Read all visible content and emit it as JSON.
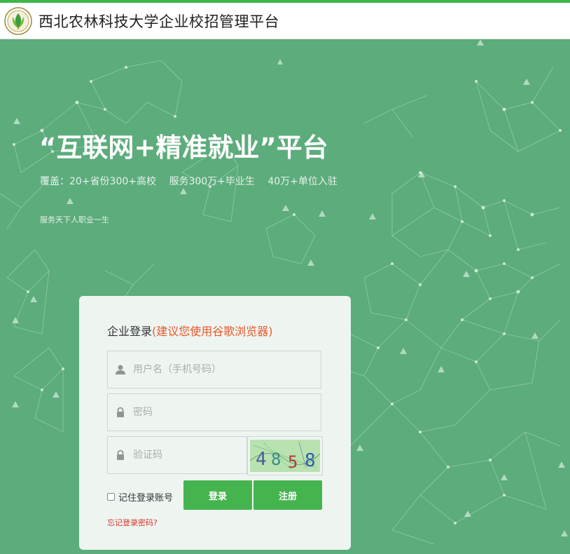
{
  "header": {
    "title": "西北农林科技大学企业校招管理平台",
    "logo_icon": "university-seal-icon"
  },
  "hero": {
    "title": "“互联网+精准就业”平台",
    "stats": [
      "覆盖：20+省份300+高校",
      "服务300万+毕业生",
      "40万+单位入驻"
    ],
    "tagline": "服务天下人职业一生"
  },
  "login": {
    "heading": "企业登录",
    "note": "(建议您使用谷歌浏览器)",
    "username_placeholder": "用户名（手机号码）",
    "password_placeholder": "密码",
    "code_placeholder": "验证码",
    "captcha_digits": [
      "4",
      "8",
      "5",
      "8"
    ],
    "remember_label": "记住登录账号",
    "login_button": "登录",
    "register_button": "注册",
    "forgot_link": "忘记登录密码?"
  },
  "colors": {
    "background": "#5cac7c",
    "accent_green": "#45b44f",
    "note_orange": "#e8572a",
    "link_red": "#d8322c"
  }
}
